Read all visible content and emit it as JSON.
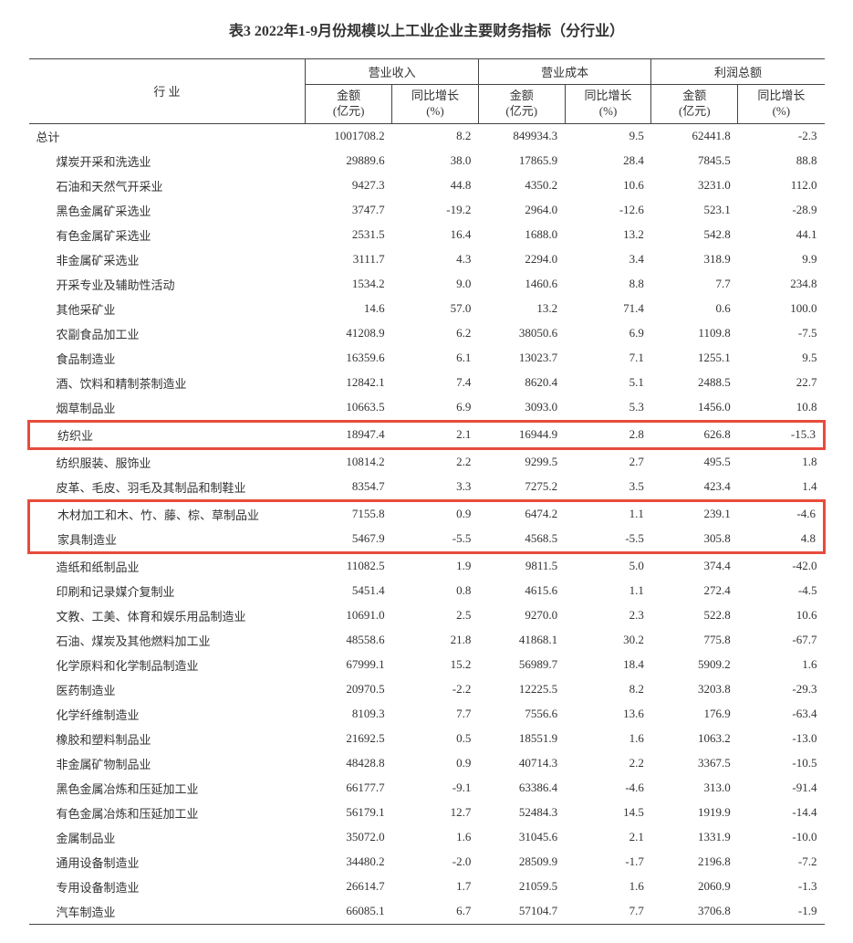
{
  "title": "表3  2022年1-9月份规模以上工业企业主要财务指标（分行业）",
  "headers": {
    "row_label": "行  业",
    "group1": "营业收入",
    "group2": "营业成本",
    "group3": "利润总额",
    "amount_label": "金额",
    "amount_unit": "(亿元)",
    "growth_label": "同比增长",
    "growth_unit": "(%)"
  },
  "total_label": "总计",
  "total": {
    "rev_amt": "1001708.2",
    "rev_g": "8.2",
    "cost_amt": "849934.3",
    "cost_g": "9.5",
    "prof_amt": "62441.8",
    "prof_g": "-2.3"
  },
  "rows": [
    {
      "label": "煤炭开采和洗选业",
      "rev_amt": "29889.6",
      "rev_g": "38.0",
      "cost_amt": "17865.9",
      "cost_g": "28.4",
      "prof_amt": "7845.5",
      "prof_g": "88.8"
    },
    {
      "label": "石油和天然气开采业",
      "rev_amt": "9427.3",
      "rev_g": "44.8",
      "cost_amt": "4350.2",
      "cost_g": "10.6",
      "prof_amt": "3231.0",
      "prof_g": "112.0"
    },
    {
      "label": "黑色金属矿采选业",
      "rev_amt": "3747.7",
      "rev_g": "-19.2",
      "cost_amt": "2964.0",
      "cost_g": "-12.6",
      "prof_amt": "523.1",
      "prof_g": "-28.9"
    },
    {
      "label": "有色金属矿采选业",
      "rev_amt": "2531.5",
      "rev_g": "16.4",
      "cost_amt": "1688.0",
      "cost_g": "13.2",
      "prof_amt": "542.8",
      "prof_g": "44.1"
    },
    {
      "label": "非金属矿采选业",
      "rev_amt": "3111.7",
      "rev_g": "4.3",
      "cost_amt": "2294.0",
      "cost_g": "3.4",
      "prof_amt": "318.9",
      "prof_g": "9.9"
    },
    {
      "label": "开采专业及辅助性活动",
      "rev_amt": "1534.2",
      "rev_g": "9.0",
      "cost_amt": "1460.6",
      "cost_g": "8.8",
      "prof_amt": "7.7",
      "prof_g": "234.8"
    },
    {
      "label": "其他采矿业",
      "rev_amt": "14.6",
      "rev_g": "57.0",
      "cost_amt": "13.2",
      "cost_g": "71.4",
      "prof_amt": "0.6",
      "prof_g": "100.0"
    },
    {
      "label": "农副食品加工业",
      "rev_amt": "41208.9",
      "rev_g": "6.2",
      "cost_amt": "38050.6",
      "cost_g": "6.9",
      "prof_amt": "1109.8",
      "prof_g": "-7.5"
    },
    {
      "label": "食品制造业",
      "rev_amt": "16359.6",
      "rev_g": "6.1",
      "cost_amt": "13023.7",
      "cost_g": "7.1",
      "prof_amt": "1255.1",
      "prof_g": "9.5"
    },
    {
      "label": "酒、饮料和精制茶制造业",
      "rev_amt": "12842.1",
      "rev_g": "7.4",
      "cost_amt": "8620.4",
      "cost_g": "5.1",
      "prof_amt": "2488.5",
      "prof_g": "22.7"
    },
    {
      "label": "烟草制品业",
      "rev_amt": "10663.5",
      "rev_g": "6.9",
      "cost_amt": "3093.0",
      "cost_g": "5.3",
      "prof_amt": "1456.0",
      "prof_g": "10.8"
    },
    {
      "label": "纺织业",
      "rev_amt": "18947.4",
      "rev_g": "2.1",
      "cost_amt": "16944.9",
      "cost_g": "2.8",
      "prof_amt": "626.8",
      "prof_g": "-15.3",
      "highlight": "single"
    },
    {
      "label": "纺织服装、服饰业",
      "rev_amt": "10814.2",
      "rev_g": "2.2",
      "cost_amt": "9299.5",
      "cost_g": "2.7",
      "prof_amt": "495.5",
      "prof_g": "1.8"
    },
    {
      "label": "皮革、毛皮、羽毛及其制品和制鞋业",
      "rev_amt": "8354.7",
      "rev_g": "3.3",
      "cost_amt": "7275.2",
      "cost_g": "3.5",
      "prof_amt": "423.4",
      "prof_g": "1.4"
    },
    {
      "label": "木材加工和木、竹、藤、棕、草制品业",
      "rev_amt": "7155.8",
      "rev_g": "0.9",
      "cost_amt": "6474.2",
      "cost_g": "1.1",
      "prof_amt": "239.1",
      "prof_g": "-4.6",
      "highlight": "top"
    },
    {
      "label": "家具制造业",
      "rev_amt": "5467.9",
      "rev_g": "-5.5",
      "cost_amt": "4568.5",
      "cost_g": "-5.5",
      "prof_amt": "305.8",
      "prof_g": "4.8",
      "highlight": "bottom"
    },
    {
      "label": "造纸和纸制品业",
      "rev_amt": "11082.5",
      "rev_g": "1.9",
      "cost_amt": "9811.5",
      "cost_g": "5.0",
      "prof_amt": "374.4",
      "prof_g": "-42.0"
    },
    {
      "label": "印刷和记录媒介复制业",
      "rev_amt": "5451.4",
      "rev_g": "0.8",
      "cost_amt": "4615.6",
      "cost_g": "1.1",
      "prof_amt": "272.4",
      "prof_g": "-4.5"
    },
    {
      "label": "文教、工美、体育和娱乐用品制造业",
      "rev_amt": "10691.0",
      "rev_g": "2.5",
      "cost_amt": "9270.0",
      "cost_g": "2.3",
      "prof_amt": "522.8",
      "prof_g": "10.6"
    },
    {
      "label": "石油、煤炭及其他燃料加工业",
      "rev_amt": "48558.6",
      "rev_g": "21.8",
      "cost_amt": "41868.1",
      "cost_g": "30.2",
      "prof_amt": "775.8",
      "prof_g": "-67.7"
    },
    {
      "label": "化学原料和化学制品制造业",
      "rev_amt": "67999.1",
      "rev_g": "15.2",
      "cost_amt": "56989.7",
      "cost_g": "18.4",
      "prof_amt": "5909.2",
      "prof_g": "1.6"
    },
    {
      "label": "医药制造业",
      "rev_amt": "20970.5",
      "rev_g": "-2.2",
      "cost_amt": "12225.5",
      "cost_g": "8.2",
      "prof_amt": "3203.8",
      "prof_g": "-29.3"
    },
    {
      "label": "化学纤维制造业",
      "rev_amt": "8109.3",
      "rev_g": "7.7",
      "cost_amt": "7556.6",
      "cost_g": "13.6",
      "prof_amt": "176.9",
      "prof_g": "-63.4"
    },
    {
      "label": "橡胶和塑料制品业",
      "rev_amt": "21692.5",
      "rev_g": "0.5",
      "cost_amt": "18551.9",
      "cost_g": "1.6",
      "prof_amt": "1063.2",
      "prof_g": "-13.0"
    },
    {
      "label": "非金属矿物制品业",
      "rev_amt": "48428.8",
      "rev_g": "0.9",
      "cost_amt": "40714.3",
      "cost_g": "2.2",
      "prof_amt": "3367.5",
      "prof_g": "-10.5"
    },
    {
      "label": "黑色金属冶炼和压延加工业",
      "rev_amt": "66177.7",
      "rev_g": "-9.1",
      "cost_amt": "63386.4",
      "cost_g": "-4.6",
      "prof_amt": "313.0",
      "prof_g": "-91.4"
    },
    {
      "label": "有色金属冶炼和压延加工业",
      "rev_amt": "56179.1",
      "rev_g": "12.7",
      "cost_amt": "52484.3",
      "cost_g": "14.5",
      "prof_amt": "1919.9",
      "prof_g": "-14.4"
    },
    {
      "label": "金属制品业",
      "rev_amt": "35072.0",
      "rev_g": "1.6",
      "cost_amt": "31045.6",
      "cost_g": "2.1",
      "prof_amt": "1331.9",
      "prof_g": "-10.0"
    },
    {
      "label": "通用设备制造业",
      "rev_amt": "34480.2",
      "rev_g": "-2.0",
      "cost_amt": "28509.9",
      "cost_g": "-1.7",
      "prof_amt": "2196.8",
      "prof_g": "-7.2"
    },
    {
      "label": "专用设备制造业",
      "rev_amt": "26614.7",
      "rev_g": "1.7",
      "cost_amt": "21059.5",
      "cost_g": "1.6",
      "prof_amt": "2060.9",
      "prof_g": "-1.3"
    },
    {
      "label": "汽车制造业",
      "rev_amt": "66085.1",
      "rev_g": "6.7",
      "cost_amt": "57104.7",
      "cost_g": "7.7",
      "prof_amt": "3706.8",
      "prof_g": "-1.9"
    }
  ]
}
